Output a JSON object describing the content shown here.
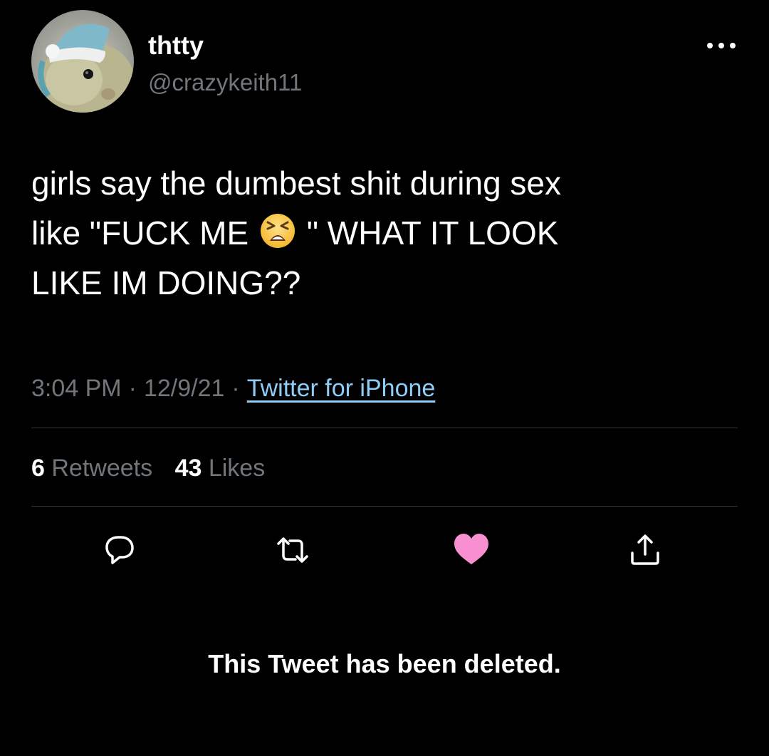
{
  "user": {
    "display_name": "thtty",
    "handle": "@crazykeith11",
    "avatar_icon": "hamster-santa-hat-avatar"
  },
  "header": {
    "more_icon": "more-horizontal-icon"
  },
  "tweet": {
    "line1": "girls say the dumbest shit during sex",
    "line2_before_emoji": "like \"FUCK ME ",
    "emoji_icon": "tired-face-emoji",
    "line2_after_emoji": " \" WHAT IT LOOK",
    "line3": "LIKE IM DOING??"
  },
  "meta": {
    "time": "3:04 PM",
    "separator": "·",
    "date": "12/9/21",
    "source": "Twitter for iPhone"
  },
  "stats": {
    "retweets_count": "6",
    "retweets_label": "Retweets",
    "likes_count": "43",
    "likes_label": "Likes"
  },
  "actions": {
    "reply_icon": "reply-icon",
    "retweet_icon": "retweet-icon",
    "like_icon": "heart-icon",
    "share_icon": "share-icon"
  },
  "colors": {
    "background": "#000000",
    "text_primary": "#ffffff",
    "text_secondary": "#71767b",
    "link": "#8ecdf8",
    "like_active": "#f78fd0",
    "divider": "#2f3336"
  },
  "status": {
    "deleted_message": "This Tweet has been deleted."
  }
}
